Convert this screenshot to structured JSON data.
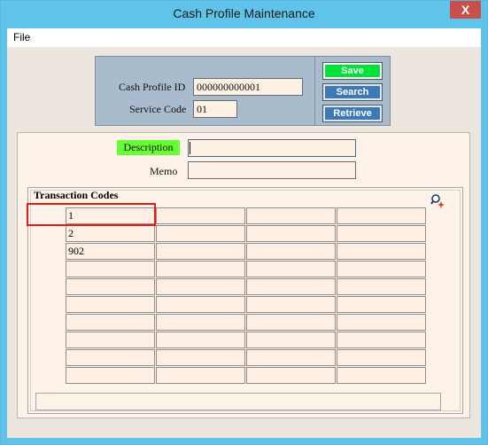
{
  "window": {
    "title": "Cash Profile Maintenance",
    "close_glyph": "X"
  },
  "menu": {
    "items": [
      "File"
    ]
  },
  "header": {
    "cash_profile_id_label": "Cash Profile ID",
    "cash_profile_id_value": "000000000001",
    "service_code_label": "Service Code",
    "service_code_value": "01"
  },
  "buttons": {
    "save": "Save",
    "search": "Search",
    "retrieve": "Retrieve"
  },
  "detail": {
    "description_label": "Description",
    "description_value": "",
    "memo_label": "Memo",
    "memo_value": ""
  },
  "transaction_codes": {
    "title": "Transaction Codes",
    "columns": [
      [
        "1",
        "2",
        "902",
        "",
        "",
        "",
        "",
        "",
        "",
        ""
      ],
      [
        "",
        "",
        "",
        "",
        "",
        "",
        "",
        "",
        "",
        ""
      ],
      [
        "",
        "",
        "",
        "",
        "",
        "",
        "",
        "",
        "",
        ""
      ],
      [
        "",
        "",
        "",
        "",
        "",
        "",
        "",
        "",
        "",
        ""
      ]
    ]
  },
  "icons": {
    "zoom": "magnifier-sparkle-icon",
    "close": "close-icon"
  },
  "colors": {
    "title_bar": "#5fc3ea",
    "save_button": "#00e13a",
    "blue_button": "#3d79b6",
    "description_label_bg": "#66ff33",
    "selection_outline": "#e21b1b"
  }
}
